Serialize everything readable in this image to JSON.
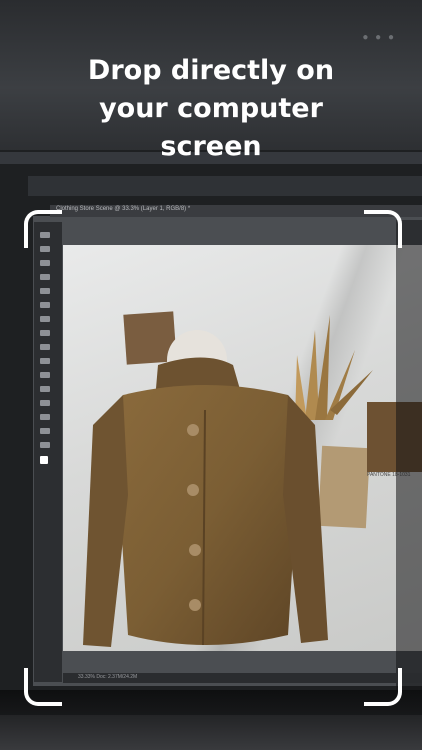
{
  "headline": {
    "line1": "Drop directly on",
    "line2": "your computer",
    "line3": "screen"
  },
  "photoshop": {
    "tab_title": "Clothing Store Scene @ 33.3% (Layer 1, RGB/8) *",
    "status_text": "33.33%   Doc: 2.37M/24.2M"
  },
  "canvas": {
    "swatch_caption": "PANTONE 18-1031"
  },
  "colors": {
    "frame_corner": "#ffffff",
    "jacket": "#7b5e34",
    "background": "#151617"
  }
}
